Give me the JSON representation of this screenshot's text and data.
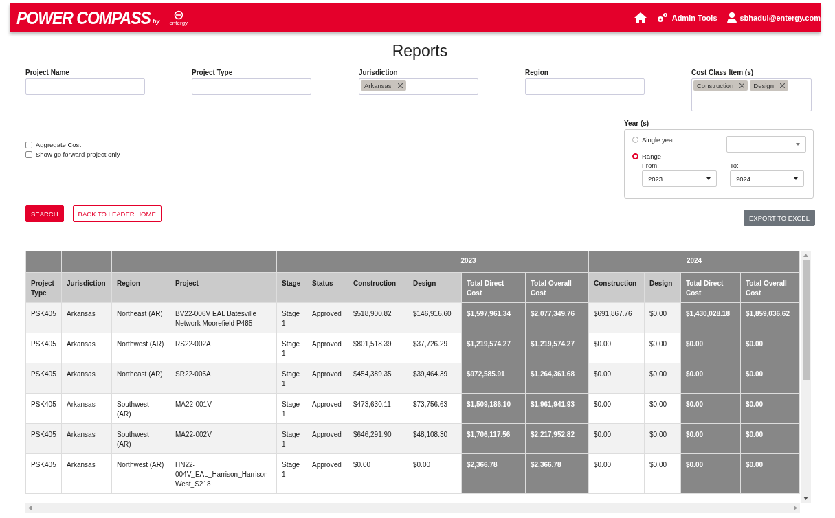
{
  "header": {
    "logo": "POWER COMPASS",
    "logo_by": "by",
    "brand": "entergy",
    "admin_link": "Admin Tools",
    "user": "sbhadul@entergy.com"
  },
  "page_title": "Reports",
  "filters": [
    {
      "label": "Project Name"
    },
    {
      "label": "Project Type"
    },
    {
      "label": "Jurisdiction",
      "tags": [
        "Arkansas"
      ]
    },
    {
      "label": "Region"
    },
    {
      "label": "Cost Class Item (s)",
      "tags": [
        "Construction",
        "Design"
      ]
    }
  ],
  "options": [
    {
      "label": "Aggregate Cost",
      "checked": false
    },
    {
      "label": "Show go forward project only",
      "checked": false
    }
  ],
  "years": {
    "label": "Year (s)",
    "modes": [
      {
        "label": "Single year",
        "selected": false
      },
      {
        "label": "Range",
        "selected": true
      }
    ],
    "from_label": "From:",
    "from": "2023",
    "to_label": "To:",
    "to": "2024"
  },
  "buttons": {
    "search": "SEARCH",
    "back": "BACK TO LEADER HOME",
    "export": "EXPORT TO EXCEL"
  },
  "table": {
    "columns": [
      {
        "label": "Project Type"
      },
      {
        "label": "Jurisdiction"
      },
      {
        "label": "Region"
      },
      {
        "label": "Project"
      },
      {
        "label": "Stage"
      },
      {
        "label": "Status"
      }
    ],
    "year_groups": [
      {
        "label": "2023",
        "columns": [
          {
            "label": "Construction",
            "kind": "cost"
          },
          {
            "label": "Design",
            "kind": "cost"
          },
          {
            "label": "Total Direct Cost",
            "kind": "total"
          },
          {
            "label": "Total Overall Cost",
            "kind": "total"
          }
        ]
      },
      {
        "label": "2024",
        "columns": [
          {
            "label": "Construction",
            "kind": "cost"
          },
          {
            "label": "Design",
            "kind": "cost"
          },
          {
            "label": "Total Direct Cost",
            "kind": "total"
          },
          {
            "label": "Total Overall Cost",
            "kind": "total"
          }
        ]
      }
    ],
    "rows": [
      {
        "cells": [
          "PSK405",
          "Arkansas",
          "Northeast (AR)",
          "BV22-006V EAL Batesville Network Moorefield P485",
          "Stage 1",
          "Approved"
        ],
        "years": [
          [
            "$518,900.82",
            "$146,916.60",
            "$1,597,961.34",
            "$2,077,349.76"
          ],
          [
            "$691,867.76",
            "$0.00",
            "$1,430,028.18",
            "$1,859,036.62"
          ]
        ]
      },
      {
        "cells": [
          "PSK405",
          "Arkansas",
          "Northwest (AR)",
          "RS22-002A",
          "Stage 1",
          "Approved"
        ],
        "years": [
          [
            "$801,518.39",
            "$37,726.29",
            "$1,219,574.27",
            "$1,219,574.27"
          ],
          [
            "$0.00",
            "$0.00",
            "$0.00",
            "$0.00"
          ]
        ]
      },
      {
        "cells": [
          "PSK405",
          "Arkansas",
          "Northeast (AR)",
          "SR22-005A",
          "Stage 1",
          "Approved"
        ],
        "years": [
          [
            "$454,389.35",
            "$39,464.39",
            "$972,585.91",
            "$1,264,361.68"
          ],
          [
            "$0.00",
            "$0.00",
            "$0.00",
            "$0.00"
          ]
        ]
      },
      {
        "cells": [
          "PSK405",
          "Arkansas",
          "Southwest (AR)",
          "MA22-001V",
          "Stage 1",
          "Approved"
        ],
        "years": [
          [
            "$473,630.11",
            "$73,756.63",
            "$1,509,186.10",
            "$1,961,941.93"
          ],
          [
            "$0.00",
            "$0.00",
            "$0.00",
            "$0.00"
          ]
        ]
      },
      {
        "cells": [
          "PSK405",
          "Arkansas",
          "Southwest (AR)",
          "MA22-002V",
          "Stage 1",
          "Approved"
        ],
        "years": [
          [
            "$646,291.90",
            "$48,108.30",
            "$1,706,117.56",
            "$2,217,952.82"
          ],
          [
            "$0.00",
            "$0.00",
            "$0.00",
            "$0.00"
          ]
        ]
      },
      {
        "cells": [
          "PSK405",
          "Arkansas",
          "Northwest (AR)",
          "HN22-004V_EAL_Harrison_Harrison West_S218",
          "Stage 1",
          "Approved"
        ],
        "years": [
          [
            "$0.00",
            "$0.00",
            "$2,366.78",
            "$2,366.78"
          ],
          [
            "$0.00",
            "$0.00",
            "$0.00",
            "$0.00"
          ]
        ]
      }
    ]
  }
}
